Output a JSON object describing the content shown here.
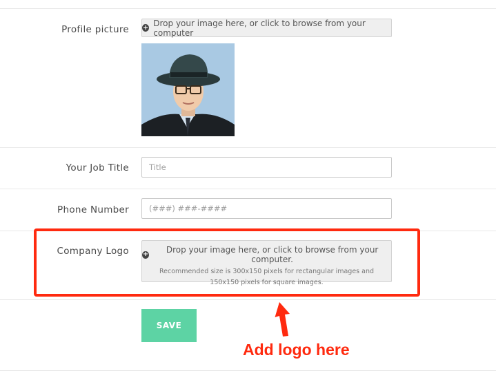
{
  "profile_picture": {
    "label": "Profile picture",
    "dropzone_text": "Drop your image here, or click to browse from your computer"
  },
  "job_title": {
    "label": "Your Job Title",
    "placeholder": "Title"
  },
  "phone": {
    "label": "Phone Number",
    "placeholder": "(###) ###-####"
  },
  "company_logo": {
    "label": "Company Logo",
    "dropzone_text": "Drop your image here, or click to browse from your computer.",
    "dropzone_hint": "Recommended size is 300x150 pixels for rectangular images and 150x150 pixels for square images."
  },
  "save_label": "SAVE",
  "annotation": {
    "text": "Add logo here",
    "color": "#ff2a0f"
  },
  "colors": {
    "save_button": "#5dd3a4",
    "highlight": "#ff2a0f",
    "dropzone_bg": "#efefef"
  },
  "icons": {
    "dropzone": "plus-circle-icon"
  }
}
